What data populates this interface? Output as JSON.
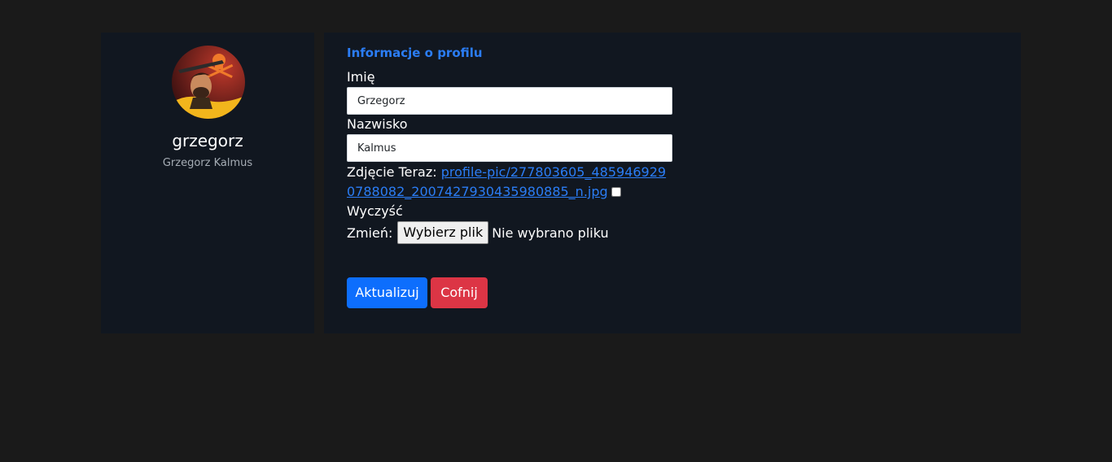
{
  "profile": {
    "username": "grzegorz",
    "full_name": "Grzegorz Kalmus"
  },
  "form": {
    "section_title": "Informacje o profilu",
    "first_name_label": "Imię",
    "first_name_value": "Grzegorz",
    "last_name_label": "Nazwisko",
    "last_name_value": "Kalmus",
    "photo_current_label": "Zdjęcie Teraz:",
    "photo_current_link": "profile-pic/277803605_4859469290788082_2007427930435980885_n.jpg",
    "clear_label": "Wyczyść",
    "clear_checked": false,
    "change_label": "Zmień:",
    "file_button_label": "Wybierz plik",
    "file_status": "Nie wybrano pliku",
    "submit_label": "Aktualizuj",
    "cancel_label": "Cofnij"
  },
  "colors": {
    "page_background": "#1a1a1a",
    "card_background": "#111720",
    "accent": "#2b7df5",
    "primary_button": "#0d6efd",
    "danger_button": "#dc3545"
  }
}
